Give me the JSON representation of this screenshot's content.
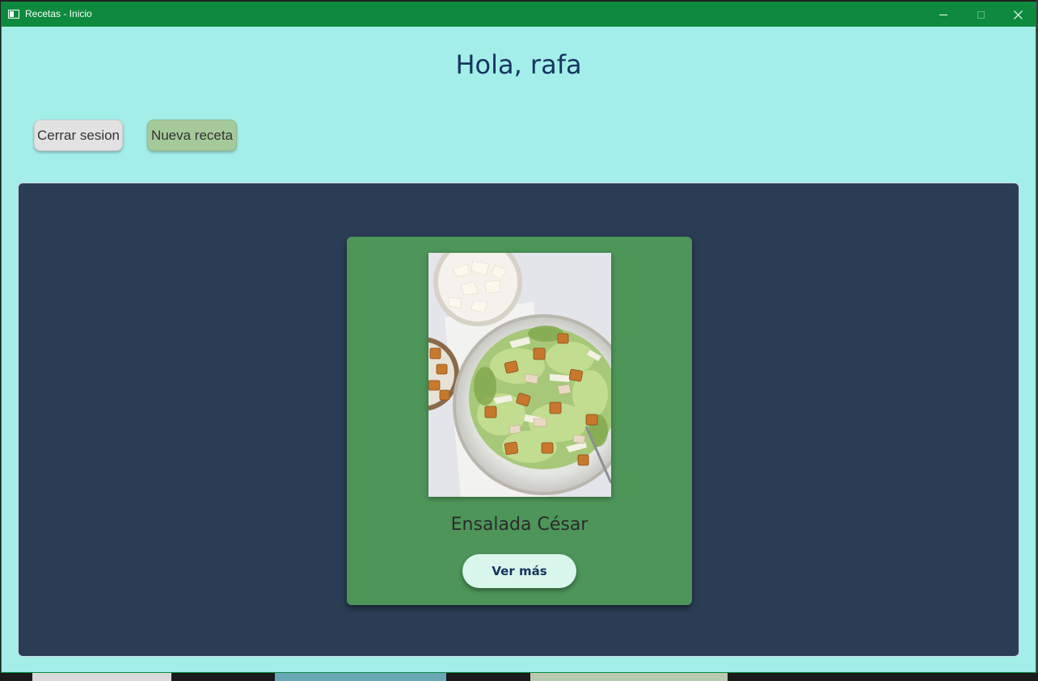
{
  "window": {
    "title": "Recetas - Inicio",
    "minimize_label": "minimize",
    "maximize_label": "maximize",
    "close_label": "close"
  },
  "header": {
    "greeting": "Hola, rafa"
  },
  "toolbar": {
    "logout_label": "Cerrar sesion",
    "new_recipe_label": "Nueva receta"
  },
  "recipes": [
    {
      "title": "Ensalada César",
      "image_icon": "caesar-salad-photo",
      "button_label": "Ver más"
    }
  ],
  "colors": {
    "titlebar": "#0e8a3e",
    "window_bg": "#a3eee9",
    "panel_bg": "#2b3d55",
    "card_bg": "#4d9559",
    "heading_text": "#16355f",
    "new_button_bg": "#a6c99a",
    "logout_button_bg": "#e2e2e2",
    "more_button_bg": "#d8f6ec"
  }
}
